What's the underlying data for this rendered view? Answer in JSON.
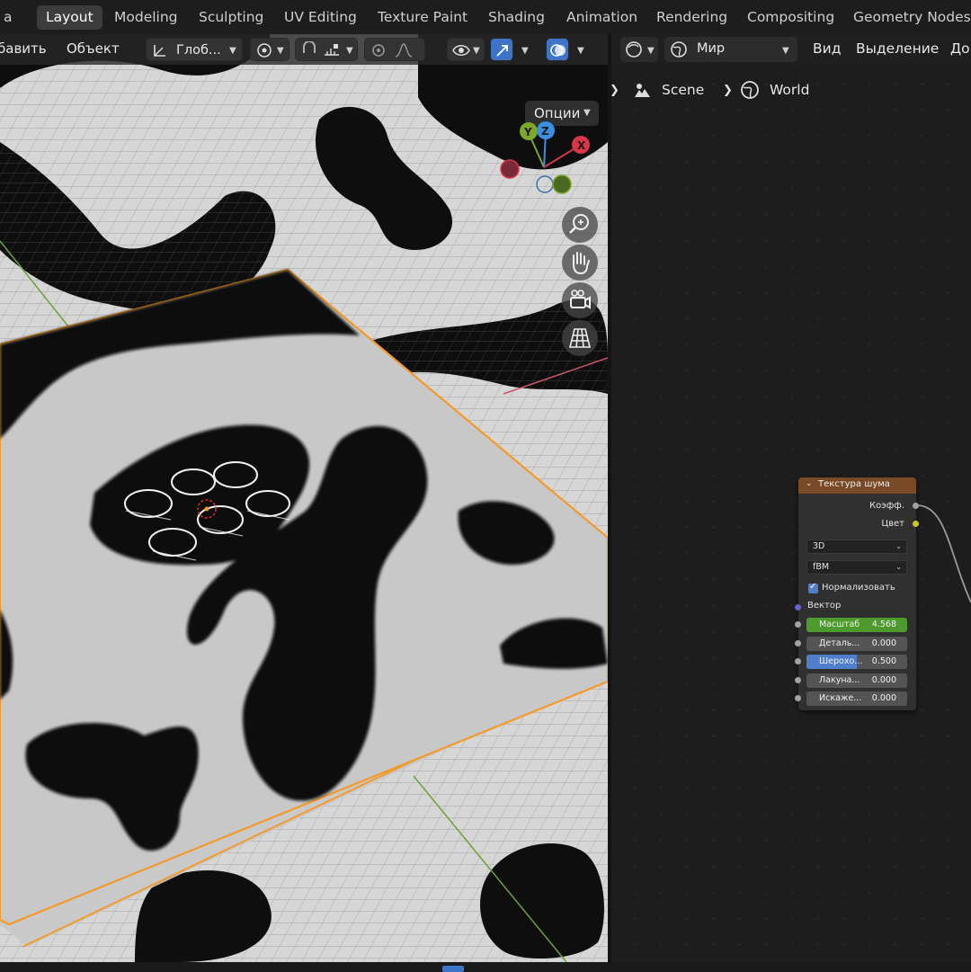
{
  "topbar": {
    "partial_menu": "a",
    "workspaces": [
      {
        "label": "Layout",
        "active": true
      },
      {
        "label": "Modeling"
      },
      {
        "label": "Sculpting"
      },
      {
        "label": "UV Editing"
      },
      {
        "label": "Texture Paint"
      },
      {
        "label": "Shading"
      },
      {
        "label": "Animation"
      },
      {
        "label": "Rendering"
      },
      {
        "label": "Compositing"
      },
      {
        "label": "Geometry Nodes"
      }
    ]
  },
  "viewport": {
    "header": {
      "menu_add": "бавить",
      "menu_object": "Объект",
      "transform_orientation": "Глоб...",
      "options_label": "Опции"
    },
    "gizmo": {
      "y": "Y",
      "z": "Z",
      "x": "X"
    }
  },
  "node_editor": {
    "header": {
      "world_selector": "Мир",
      "menu_view": "Вид",
      "menu_select": "Выделение",
      "menu_add_partial": "До"
    },
    "breadcrumb": {
      "scene": "Scene",
      "world": "World"
    },
    "node": {
      "title": "Текстура шума",
      "output_fac": "Коэфф.",
      "output_color": "Цвет",
      "dimensions": "3D",
      "type": "fBM",
      "normalize_label": "Нормализовать",
      "vector_label": "Вектор",
      "fields": [
        {
          "name": "Масштаб",
          "value": "4.568"
        },
        {
          "name": "Деталь...",
          "value": "0.000"
        },
        {
          "name": "Шерохо...",
          "value": "0.500"
        },
        {
          "name": "Лакуна...",
          "value": "0.000"
        },
        {
          "name": "Искаже...",
          "value": "0.000"
        }
      ]
    }
  },
  "colors": {
    "accent_blue": "#3e74c8",
    "node_header": "#7a4a26",
    "selection_orange": "#f39a2b",
    "axis_x": "#d8344a",
    "axis_y": "#7da827",
    "axis_z": "#3a8fe0"
  }
}
